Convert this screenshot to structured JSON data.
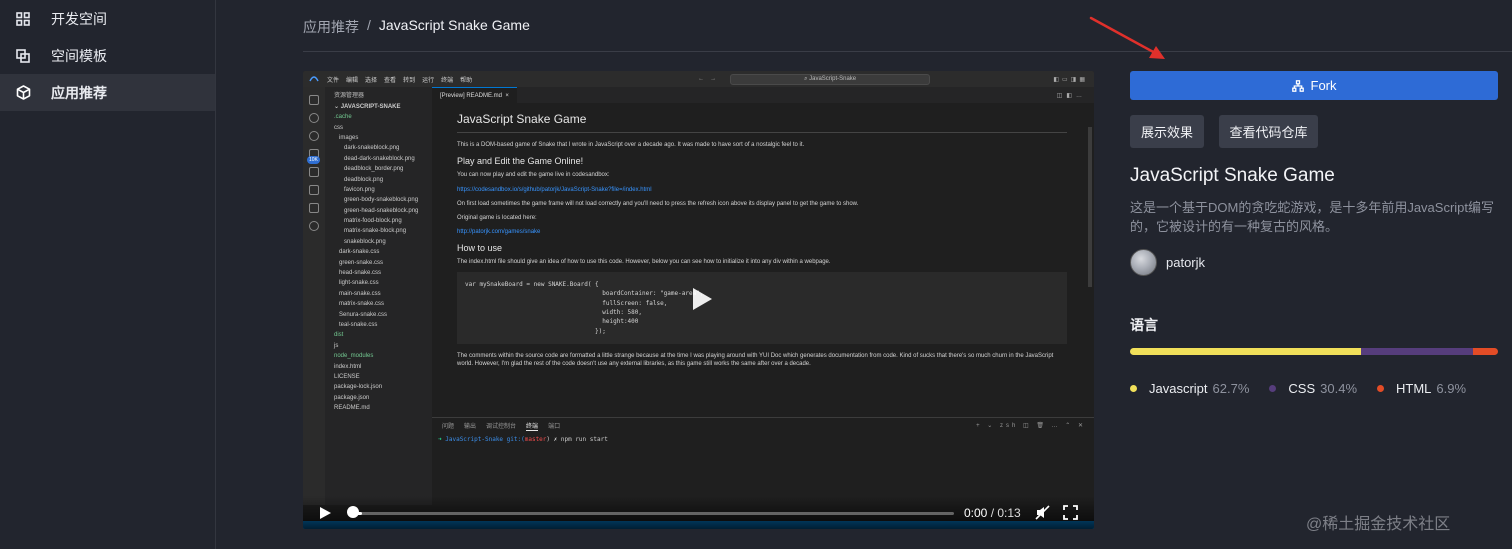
{
  "sidebar": {
    "items": [
      {
        "label": "开发空间",
        "icon": "grid-icon",
        "active": false
      },
      {
        "label": "空间模板",
        "icon": "template-icon",
        "active": false
      },
      {
        "label": "应用推荐",
        "icon": "cube-icon",
        "active": true
      }
    ]
  },
  "breadcrumb": {
    "parent": "应用推荐",
    "separator": "/",
    "current": "JavaScript Snake Game"
  },
  "video": {
    "ide": {
      "menu": [
        "文件",
        "编辑",
        "选择",
        "查看",
        "转到",
        "运行",
        "终端",
        "帮助"
      ],
      "search": "JavaScript-Snake",
      "explorer_title": "资源管理器",
      "root": "JAVASCRIPT-SNAKE",
      "tree": [
        {
          "name": ".cache",
          "indent": 1,
          "color": "#73c991"
        },
        {
          "name": "css",
          "indent": 1,
          "color": "#cccccc"
        },
        {
          "name": "images",
          "indent": 2,
          "color": "#cccccc"
        },
        {
          "name": "dark-snakeblock.png",
          "indent": 3,
          "color": "#cccccc"
        },
        {
          "name": "dead-dark-snakeblock.png",
          "indent": 3,
          "color": "#cccccc"
        },
        {
          "name": "deadblock_border.png",
          "indent": 3,
          "color": "#cccccc"
        },
        {
          "name": "deadblock.png",
          "indent": 3,
          "color": "#cccccc"
        },
        {
          "name": "favicon.png",
          "indent": 3,
          "color": "#cccccc"
        },
        {
          "name": "green-body-snakeblock.png",
          "indent": 3,
          "color": "#cccccc"
        },
        {
          "name": "green-head-snakeblock.png",
          "indent": 3,
          "color": "#cccccc"
        },
        {
          "name": "matrix-food-block.png",
          "indent": 3,
          "color": "#cccccc"
        },
        {
          "name": "matrix-snake-block.png",
          "indent": 3,
          "color": "#cccccc"
        },
        {
          "name": "snakeblock.png",
          "indent": 3,
          "color": "#cccccc"
        },
        {
          "name": "dark-snake.css",
          "indent": 2,
          "color": "#cccccc"
        },
        {
          "name": "green-snake.css",
          "indent": 2,
          "color": "#cccccc"
        },
        {
          "name": "head-snake.css",
          "indent": 2,
          "color": "#cccccc"
        },
        {
          "name": "light-snake.css",
          "indent": 2,
          "color": "#cccccc"
        },
        {
          "name": "main-snake.css",
          "indent": 2,
          "color": "#cccccc"
        },
        {
          "name": "matrix-snake.css",
          "indent": 2,
          "color": "#cccccc"
        },
        {
          "name": "Senura-snake.css",
          "indent": 2,
          "color": "#cccccc"
        },
        {
          "name": "teal-snake.css",
          "indent": 2,
          "color": "#cccccc"
        },
        {
          "name": "dist",
          "indent": 1,
          "color": "#73c991"
        },
        {
          "name": "js",
          "indent": 1,
          "color": "#cccccc"
        },
        {
          "name": "node_modules",
          "indent": 1,
          "color": "#73c991"
        },
        {
          "name": "index.html",
          "indent": 1,
          "color": "#cccccc"
        },
        {
          "name": "LICENSE",
          "indent": 1,
          "color": "#cccccc"
        },
        {
          "name": "package-lock.json",
          "indent": 1,
          "color": "#cccccc"
        },
        {
          "name": "package.json",
          "indent": 1,
          "color": "#cccccc"
        },
        {
          "name": "README.md",
          "indent": 1,
          "color": "#cccccc"
        }
      ],
      "tab": "[Preview] README.md",
      "readme": {
        "h1": "JavaScript Snake Game",
        "p1": "This is a DOM-based game of Snake that I wrote in JavaScript over a decade ago. It was made to have sort of a nostalgic feel to it.",
        "h2a": "Play and Edit the Game Online!",
        "p2": "You can now play and edit the game live in codesandbox:",
        "link1": "https://codesandbox.io/s/github/patorjk/JavaScript-Snake?file=/index.html",
        "p3": "On first load sometimes the game frame will not load correctly and you'll need to press the refresh icon above its display panel to get the game to show.",
        "p4": "Original game is located here:",
        "link2": "http://patorjk.com/games/snake",
        "h2b": "How to use",
        "p5": "The index.html file should give an idea of how to use this code. However, below you can see how to initialize it into any div within a webpage.",
        "code": "var mySnakeBoard = new SNAKE.Board( {\n                                      boardContainer: \"game-area\",\n                                      fullScreen: false,\n                                      width: 580,\n                                      height:400\n                                    });",
        "p6": "The comments within the source code are formatted a little strange because at the time I was playing around with YUI Doc which generates documentation from code. Kind of sucks that there's so much churn in the JavaScript world. However, I'm glad the rest of the code doesn't use any external libraries, as this game still works the same after over a decade."
      },
      "terminal_tabs": [
        "问题",
        "输出",
        "调试控制台",
        "终端",
        "端口"
      ],
      "terminal_actions": "+ ⌄ zsh ◫ 🗑 … ⌃ ✕",
      "terminal_prompt": {
        "arrow": "➜",
        "dir": "JavaScript-Snake",
        "git": "git:(",
        "branch": "master",
        "rest": ") ✗ npm run start"
      }
    },
    "player": {
      "current_time": "0:00",
      "separator": " / ",
      "duration": "0:13",
      "progress": 0.02
    }
  },
  "actions": {
    "fork_label": "Fork",
    "demo_label": "展示效果",
    "repo_label": "查看代码仓库"
  },
  "app": {
    "title": "JavaScript Snake Game",
    "description": "这是一个基于DOM的贪吃蛇游戏，是十多年前用JavaScript编写的，它被设计的有一种复古的风格。",
    "author": "patorjk"
  },
  "languages": {
    "title": "语言",
    "items": [
      {
        "name": "Javascript",
        "percent": "62.7%",
        "value": 62.7,
        "color": "#f1e05a"
      },
      {
        "name": "CSS",
        "percent": "30.4%",
        "value": 30.4,
        "color": "#563d7c"
      },
      {
        "name": "HTML",
        "percent": "6.9%",
        "value": 6.9,
        "color": "#e34c26"
      }
    ]
  },
  "watermark": "@稀土掘金技术社区"
}
